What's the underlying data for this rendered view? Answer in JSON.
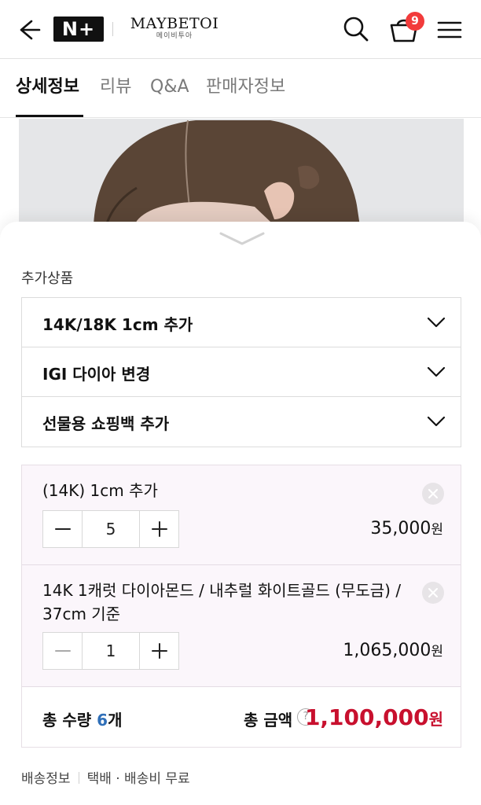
{
  "header": {
    "logo_text": "N+",
    "brand_name": "MAYBETOI",
    "brand_sub": "메이비투아",
    "cart_count": "9"
  },
  "tabs": [
    {
      "label": "상세정보",
      "active": true
    },
    {
      "label": "리뷰",
      "active": false
    },
    {
      "label": "Q&A",
      "active": false
    },
    {
      "label": "판매자정보",
      "active": false
    }
  ],
  "sheet": {
    "section_label": "추가상품",
    "addons": [
      {
        "label": "14K/18K 1cm 추가"
      },
      {
        "label": "IGI 다이아 변경"
      },
      {
        "label": "선물용 쇼핑백 추가"
      }
    ],
    "cart_items": [
      {
        "name": "(14K) 1cm 추가",
        "quantity": "5",
        "price": "35,000",
        "currency": "원"
      },
      {
        "name": "14K 1캐럿 다이아몬드 / 내추럴 화이트골드 (무도금) / 37cm 기준",
        "quantity": "1",
        "price": "1,065,000",
        "currency": "원"
      }
    ],
    "summary": {
      "qty_label": "총 수량",
      "qty_value": "6",
      "qty_unit": "개",
      "total_label": "총 금액",
      "help_symbol": "?",
      "total_value": "1,100,000",
      "total_currency": "원"
    },
    "shipping": {
      "label": "배송정보",
      "value": "택배 · 배송비 무료"
    }
  },
  "colors": {
    "accent_red": "#c8102e",
    "badge_red": "#f23b3b",
    "count_blue": "#2f6fb8"
  }
}
